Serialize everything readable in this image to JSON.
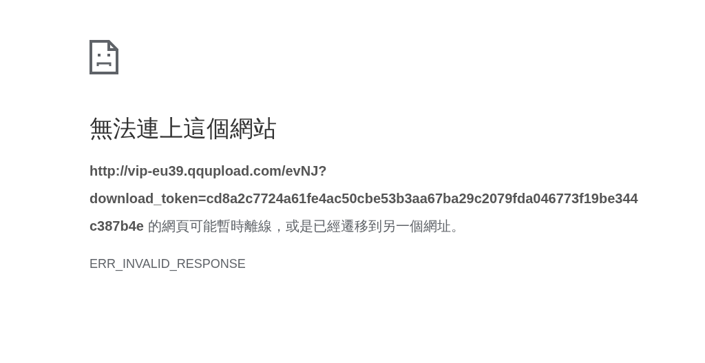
{
  "error_page": {
    "heading": "無法連上這個網站",
    "message": "**http://vip-eu39.qqupload.com/evNJ?download_token=cd8a2c7724a61fe4ac50cbe53b3aa67ba29c2079fda046773f19be344c387b4e** 的網頁可能暫時離線，或是已經遷移到另一個網址。",
    "error_code": "ERR_INVALID_RESPONSE"
  }
}
